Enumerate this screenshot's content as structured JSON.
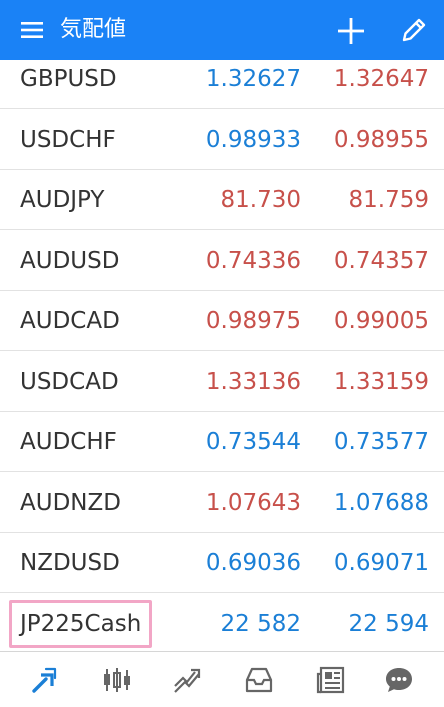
{
  "header": {
    "title": "気配値",
    "menu_icon": "hamburger-menu-icon",
    "add_icon": "plus-icon",
    "edit_icon": "pencil-icon"
  },
  "colors": {
    "brand": "#1a82f6",
    "up": "#1b7fd6",
    "down": "#c7504a",
    "highlight": "#f2a6c6"
  },
  "quotes": [
    {
      "symbol": "GBPUSD",
      "bid": "1.32627",
      "ask": "1.32647",
      "bid_dir": "up",
      "ask_dir": "down"
    },
    {
      "symbol": "USDCHF",
      "bid": "0.98933",
      "ask": "0.98955",
      "bid_dir": "up",
      "ask_dir": "down"
    },
    {
      "symbol": "AUDJPY",
      "bid": "81.730",
      "ask": "81.759",
      "bid_dir": "down",
      "ask_dir": "down"
    },
    {
      "symbol": "AUDUSD",
      "bid": "0.74336",
      "ask": "0.74357",
      "bid_dir": "down",
      "ask_dir": "down"
    },
    {
      "symbol": "AUDCAD",
      "bid": "0.98975",
      "ask": "0.99005",
      "bid_dir": "down",
      "ask_dir": "down"
    },
    {
      "symbol": "USDCAD",
      "bid": "1.33136",
      "ask": "1.33159",
      "bid_dir": "down",
      "ask_dir": "down"
    },
    {
      "symbol": "AUDCHF",
      "bid": "0.73544",
      "ask": "0.73577",
      "bid_dir": "up",
      "ask_dir": "up"
    },
    {
      "symbol": "AUDNZD",
      "bid": "1.07643",
      "ask": "1.07688",
      "bid_dir": "down",
      "ask_dir": "up"
    },
    {
      "symbol": "NZDUSD",
      "bid": "0.69036",
      "ask": "0.69071",
      "bid_dir": "up",
      "ask_dir": "up"
    },
    {
      "symbol": "JP225Cash",
      "bid": "22 582",
      "ask": "22 594",
      "bid_dir": "up",
      "ask_dir": "up",
      "highlighted": true
    }
  ],
  "bottom_nav": [
    {
      "name": "quotes-icon",
      "active": true
    },
    {
      "name": "chart-icon",
      "active": false
    },
    {
      "name": "trade-icon",
      "active": false
    },
    {
      "name": "history-icon",
      "active": false
    },
    {
      "name": "news-icon",
      "active": false
    },
    {
      "name": "chat-icon",
      "active": false
    }
  ]
}
